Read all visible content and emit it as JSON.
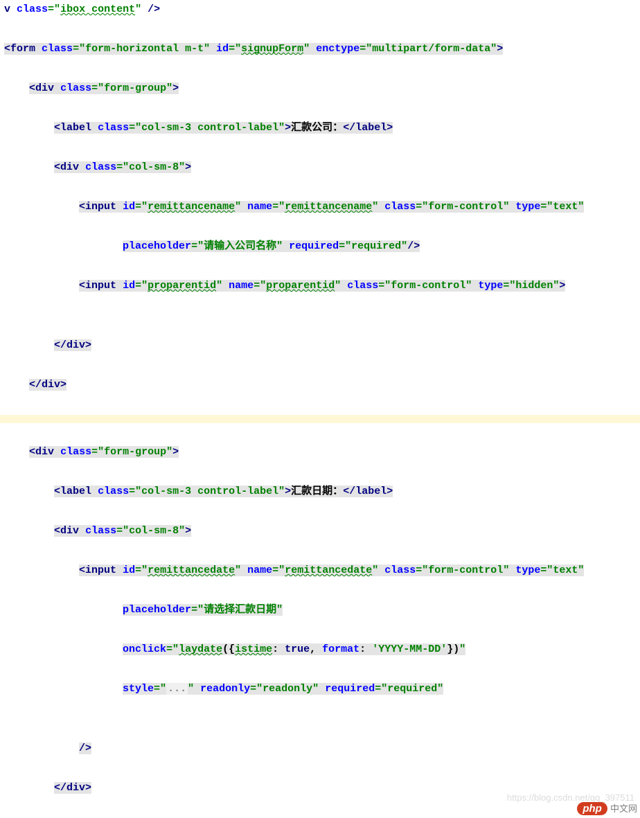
{
  "line0": {
    "pre": "v ",
    "attr1": "class",
    "eq": "=",
    "val1": "ibox content",
    "tail": " /"
  },
  "form": {
    "tag": "form",
    "attr1": "class",
    "val1": "form-horizontal m-t",
    "attr2": "id",
    "val2": "signupForm",
    "attr3": "enctype",
    "val3": "multipart/form-data"
  },
  "g1": {
    "divOpen": {
      "tag": "div",
      "attr": "class",
      "val": "form-group"
    },
    "label": {
      "tag": "label",
      "attr": "class",
      "val": "col-sm-3 control-label",
      "text": "汇款公司："
    },
    "col": {
      "tag": "div",
      "attr": "class",
      "val": "col-sm-8"
    },
    "input1": {
      "tag": "input",
      "id": "remittancename",
      "name": "remittancename",
      "cls": "form-control",
      "type": "text",
      "placeholder": "请输入公司名称",
      "req": "required"
    },
    "input2": {
      "tag": "input",
      "id": "proparentid",
      "name": "proparentid",
      "cls": "form-control",
      "type": "hidden"
    },
    "closediv": "div"
  },
  "g2": {
    "divOpen": {
      "tag": "div",
      "attr": "class",
      "val": "form-group"
    },
    "label": {
      "tag": "label",
      "attr": "class",
      "val": "col-sm-3 control-label",
      "text": "汇款日期："
    },
    "col": {
      "tag": "div",
      "attr": "class",
      "val": "col-sm-8"
    },
    "input": {
      "tag": "input",
      "id": "remittancedate",
      "name": "remittancedate",
      "cls": "form-control",
      "type": "text",
      "placeholder": "请选择汇款日期",
      "onclick_fn": "laydate",
      "onclick_arg_istime": "istime",
      "onclick_arg_true": "true",
      "onclick_arg_format": "format",
      "onclick_arg_fmtval": "'YYYY-MM-DD'",
      "style": "...",
      "readonly": "readonly",
      "req": "required"
    }
  },
  "logo": {
    "php": "php",
    "cn": "中文网"
  },
  "faded": "https://blog.csdn.net/qq_397511"
}
